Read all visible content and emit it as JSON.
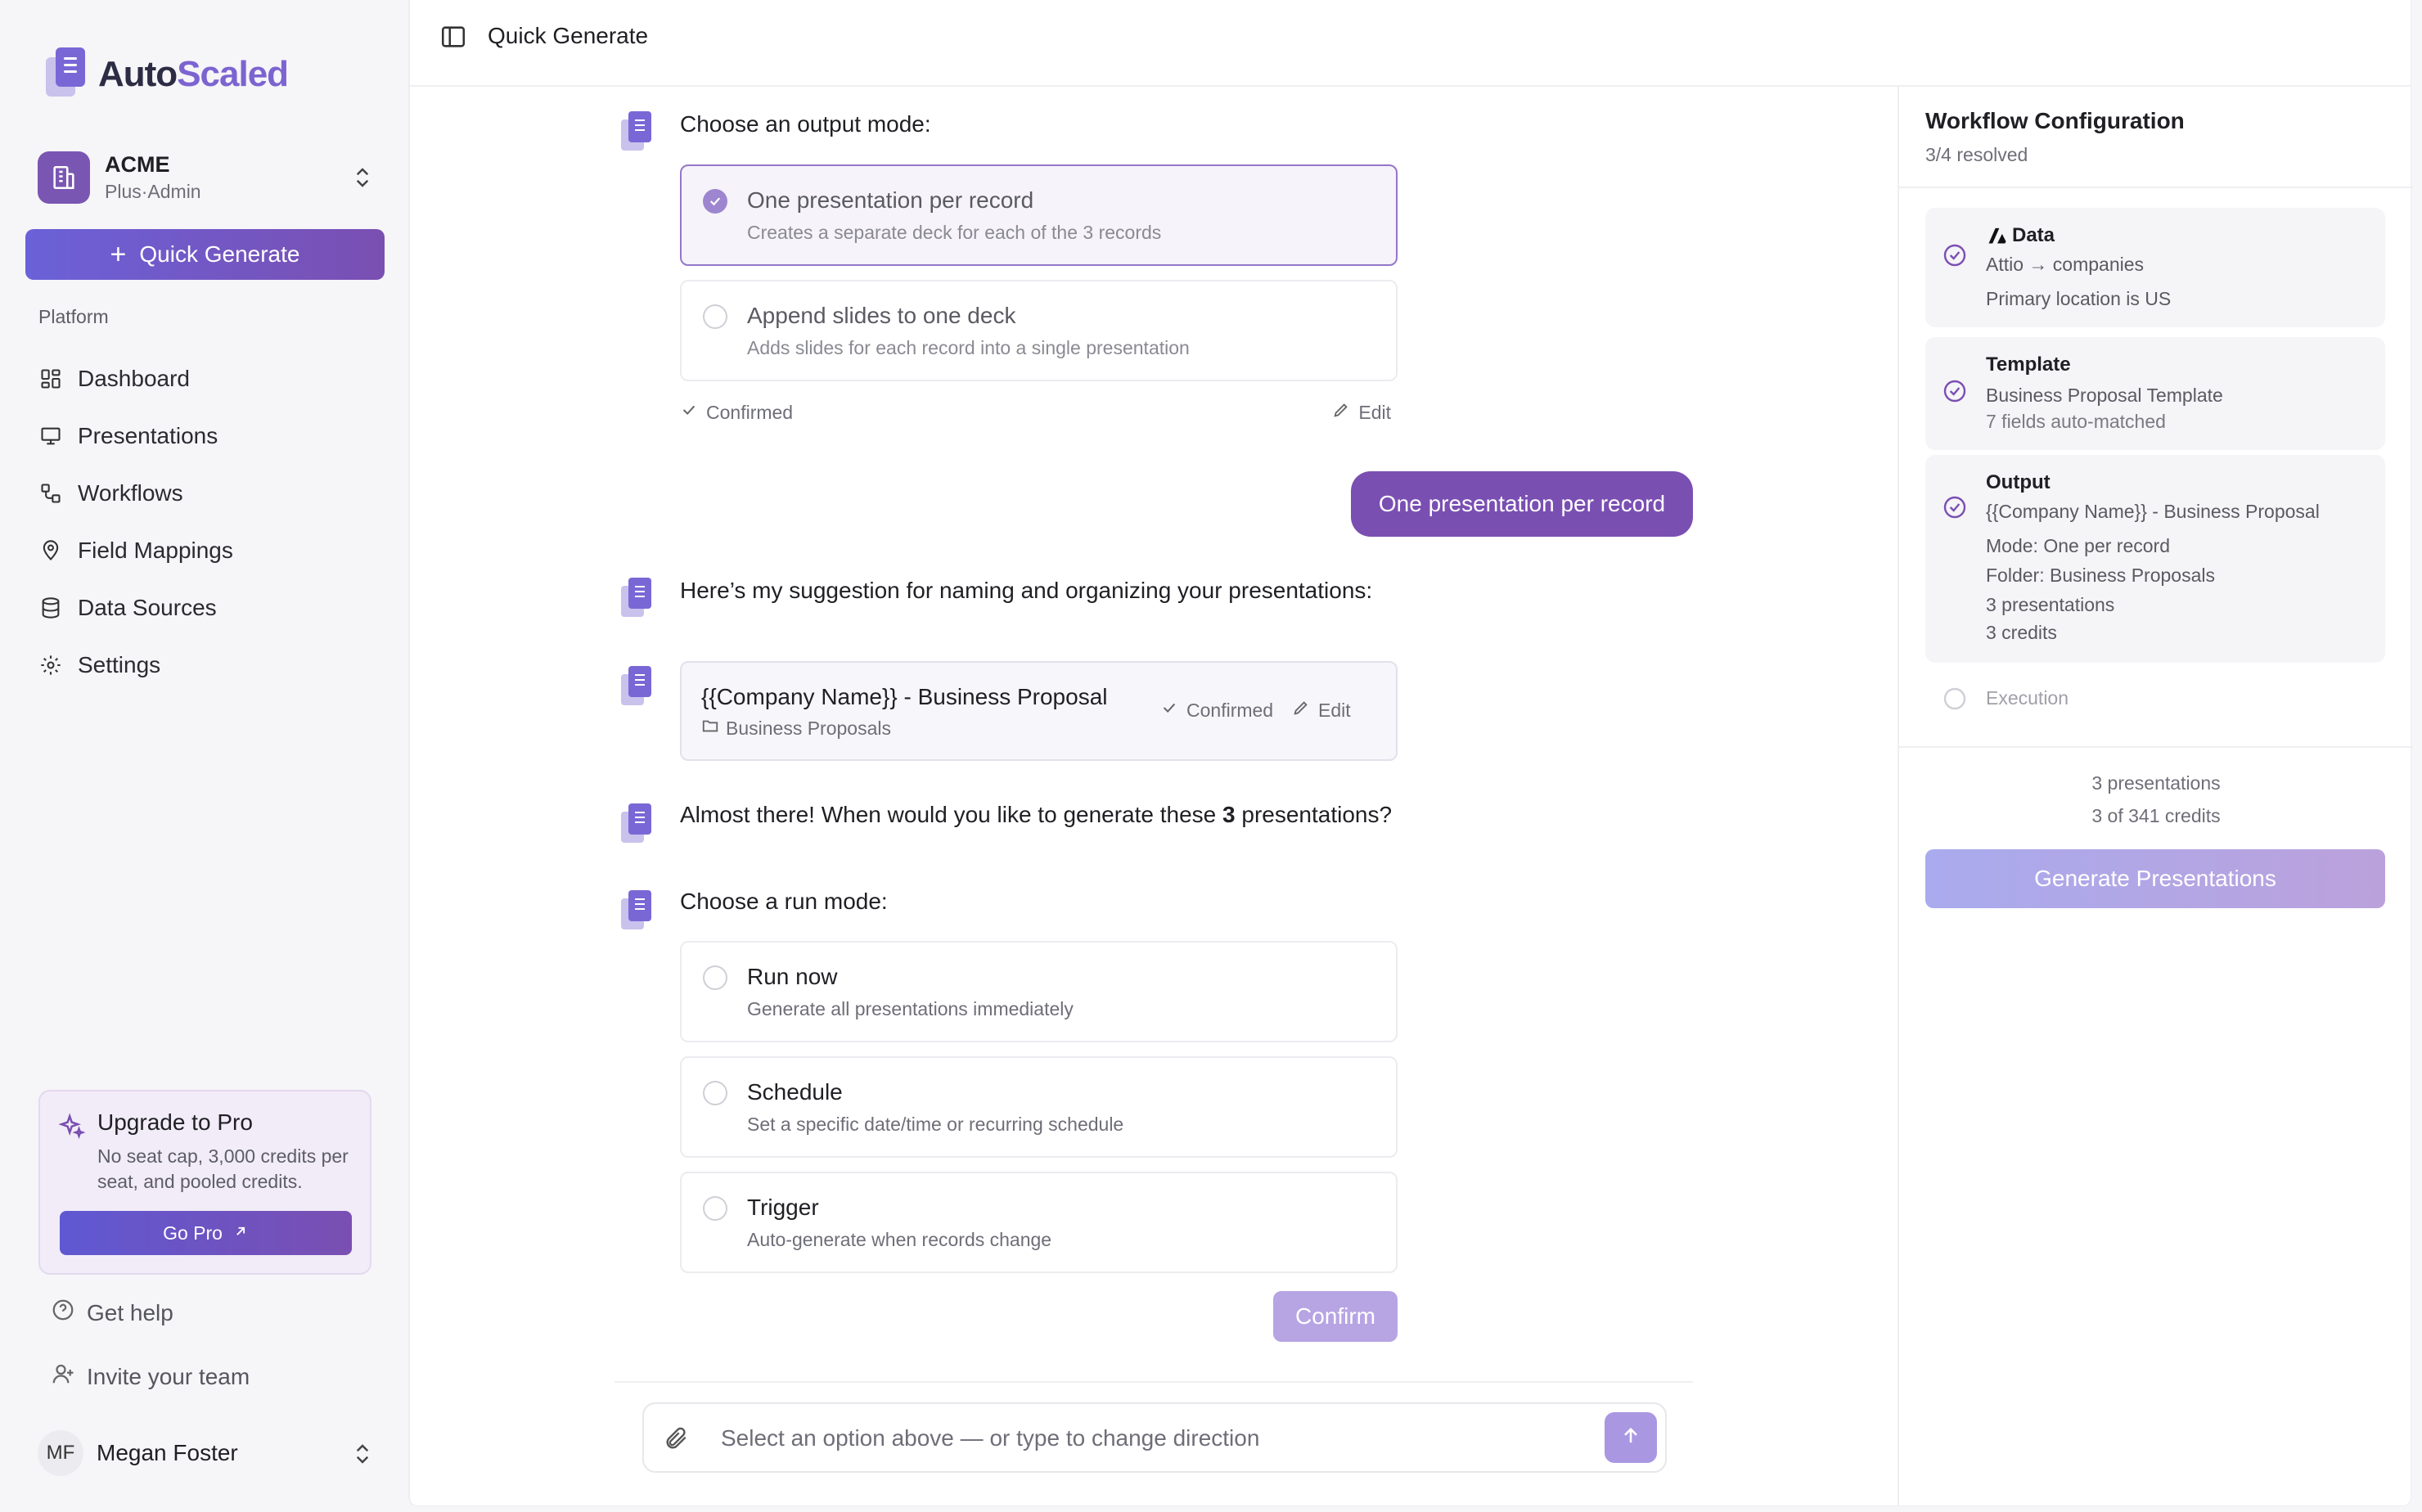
{
  "app": {
    "brand_part1": "Auto",
    "brand_part2": "Scaled"
  },
  "org": {
    "name": "ACME",
    "role": "Plus·Admin"
  },
  "sidebar": {
    "quick_generate": "Quick Generate",
    "section_label": "Platform",
    "items": [
      {
        "label": "Dashboard",
        "icon": "dashboard-icon"
      },
      {
        "label": "Presentations",
        "icon": "presentation-icon"
      },
      {
        "label": "Workflows",
        "icon": "workflow-icon"
      },
      {
        "label": "Field Mappings",
        "icon": "map-pin-icon"
      },
      {
        "label": "Data Sources",
        "icon": "database-icon"
      },
      {
        "label": "Settings",
        "icon": "gear-icon"
      }
    ],
    "upgrade": {
      "title": "Upgrade to Pro",
      "description": "No seat cap, 3,000 credits per seat, and pooled credits.",
      "button": "Go Pro"
    },
    "get_help": "Get help",
    "invite": "Invite your team",
    "user": {
      "initials": "MF",
      "name": "Megan Foster"
    }
  },
  "topbar": {
    "title": "Quick Generate"
  },
  "chat": {
    "output_prompt": "Choose an output mode:",
    "output_options": [
      {
        "title": "One presentation per record",
        "desc": "Creates a separate deck for each of the 3 records",
        "selected": true
      },
      {
        "title": "Append slides to one deck",
        "desc": "Adds slides for each record into a single presentation",
        "selected": false
      }
    ],
    "confirmed_label": "Confirmed",
    "edit_label": "Edit",
    "user_reply": "One presentation per record",
    "naming_intro": "Here’s my suggestion for naming and organizing your presentations:",
    "naming": {
      "title": "{{Company Name}} - Business Proposal",
      "folder": "Business Proposals",
      "status": "Confirmed",
      "edit": "Edit"
    },
    "almost_pre": "Almost there! When would you like to generate these ",
    "almost_count": "3",
    "almost_post": " presentations?",
    "run_prompt": "Choose a run mode:",
    "run_options": [
      {
        "title": "Run now",
        "desc": "Generate all presentations immediately"
      },
      {
        "title": "Schedule",
        "desc": "Set a specific date/time or recurring schedule"
      },
      {
        "title": "Trigger",
        "desc": "Auto-generate when records change"
      }
    ],
    "confirm_button": "Confirm",
    "composer_placeholder": "Select an option above — or type to change direction"
  },
  "config": {
    "title": "Workflow Configuration",
    "progress": "3/4 resolved",
    "steps": {
      "data": {
        "title": "Data",
        "line1": "Attio → companies",
        "line2": "Primary location is US"
      },
      "template": {
        "title": "Template",
        "line1": "Business Proposal Template",
        "line2": "7 fields auto-matched"
      },
      "output": {
        "title": "Output",
        "line1": "{{Company Name}} - Business Proposal",
        "line2": "Mode: One per record",
        "line3": "Folder: Business Proposals",
        "line4": "3 presentations",
        "line5": "3 credits"
      },
      "execution": {
        "title": "Execution"
      }
    },
    "summary_presentations": "3 presentations",
    "summary_credits": "3 of 341 credits",
    "generate_button": "Generate Presentations"
  },
  "colors": {
    "accent": "#7a4fb2",
    "accent_light": "#9d86cf",
    "brand_blue": "#6b61d8"
  }
}
